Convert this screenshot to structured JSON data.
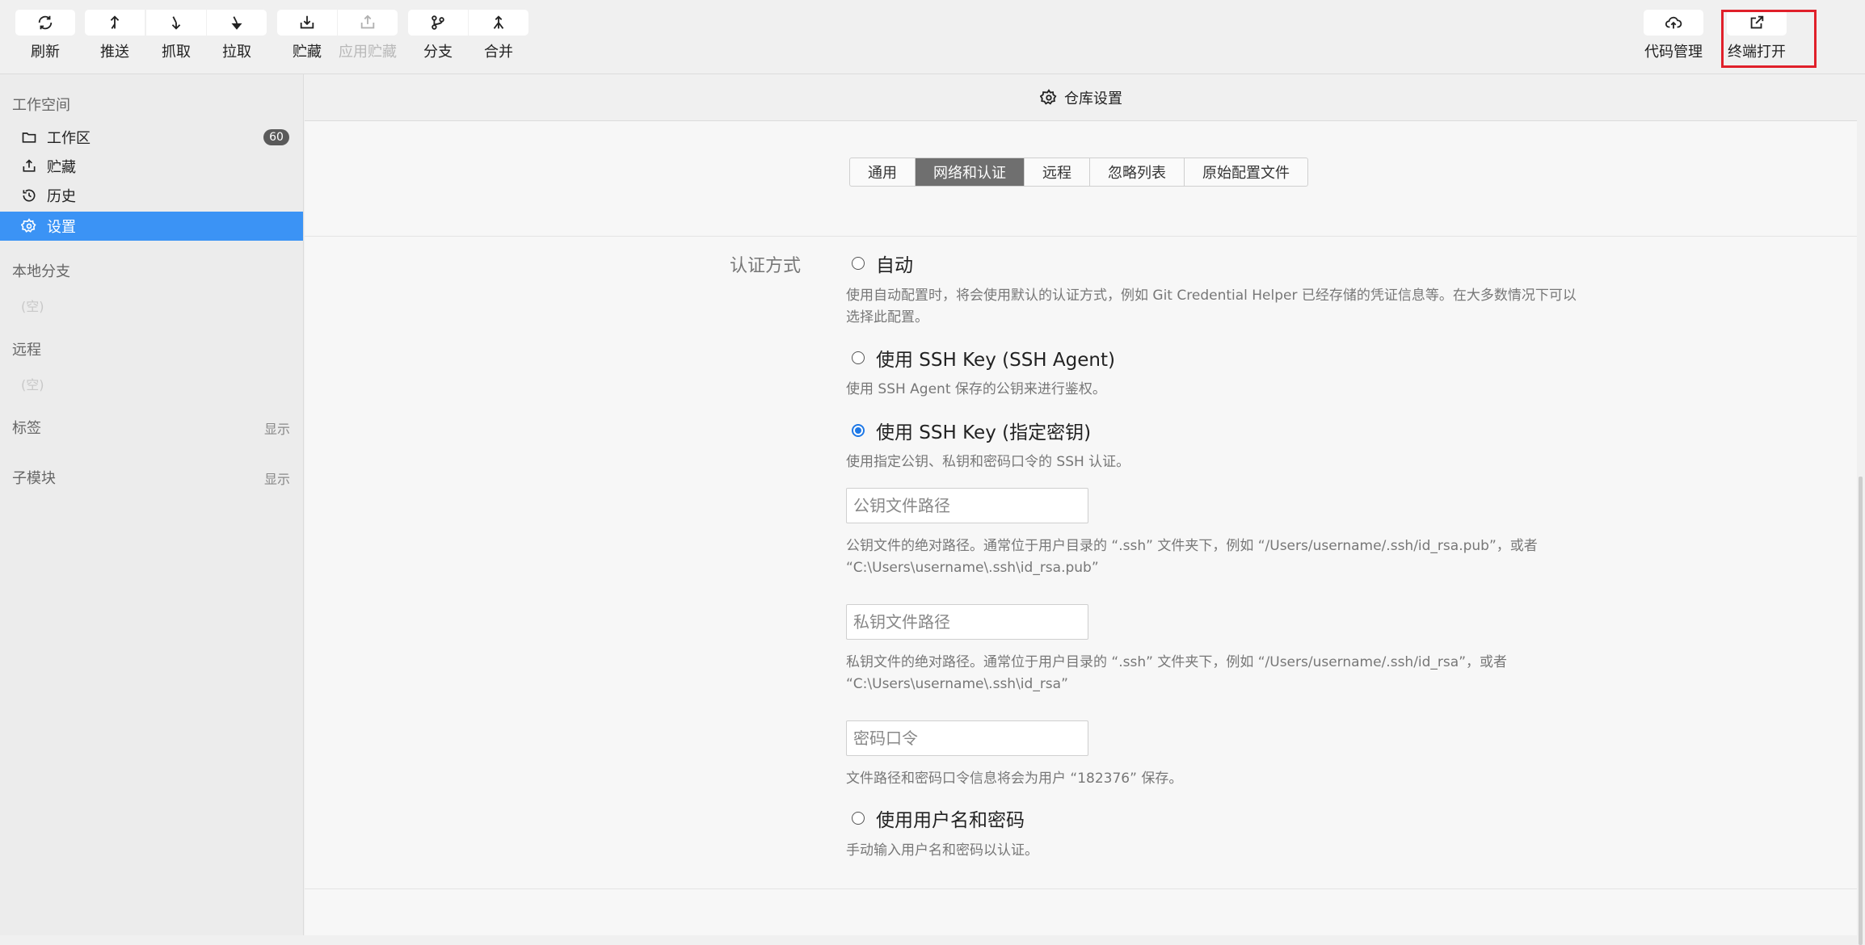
{
  "toolbar": {
    "refresh": "刷新",
    "push": "推送",
    "fetch": "抓取",
    "pull": "拉取",
    "stash": "贮藏",
    "apply_stash": "应用贮藏",
    "branch": "分支",
    "merge": "合并",
    "code_management": "代码管理",
    "open_in_terminal": "终端打开"
  },
  "sidebar": {
    "workspace_title": "工作空间",
    "items": [
      {
        "label": "工作区",
        "badge": "60"
      },
      {
        "label": "贮藏"
      },
      {
        "label": "历史"
      },
      {
        "label": "设置"
      }
    ],
    "local_branches": "本地分支",
    "local_empty": "(空)",
    "remotes": "远程",
    "remotes_empty": "(空)",
    "tags": "标签",
    "tags_show": "显示",
    "submodules": "子模块",
    "submodules_show": "显示"
  },
  "main": {
    "title": "仓库设置",
    "tabs": [
      "通用",
      "网络和认证",
      "远程",
      "忽略列表",
      "原始配置文件"
    ],
    "active_tab": "网络和认证",
    "auth_label": "认证方式",
    "options": {
      "auto": {
        "label": "自动",
        "desc": "使用自动配置时，将会使用默认的认证方式，例如 Git Credential Helper 已经存储的凭证信息等。在大多数情况下可以选择此配置。"
      },
      "ssh_agent": {
        "label": "使用 SSH Key (SSH Agent)",
        "desc": "使用 SSH Agent 保存的公钥来进行鉴权。"
      },
      "ssh_key": {
        "label": "使用 SSH Key (指定密钥)",
        "desc": "使用指定公钥、私钥和密码口令的 SSH 认证。"
      },
      "user_pass": {
        "label": "使用用户名和密码",
        "desc": "手动输入用户名和密码以认证。"
      }
    },
    "selected_option": "ssh_key",
    "public_key": {
      "value": "",
      "placeholder": "公钥文件路径",
      "desc": "公钥文件的绝对路径。通常位于用户目录的 “.ssh” 文件夹下，例如 “/Users/username/.ssh/id_rsa.pub”，或者 “C:\\Users\\username\\.ssh\\id_rsa.pub”"
    },
    "private_key": {
      "value": "",
      "placeholder": "私钥文件路径",
      "desc": "私钥文件的绝对路径。通常位于用户目录的 “.ssh” 文件夹下，例如 “/Users/username/.ssh/id_rsa”，或者 “C:\\Users\\username\\.ssh\\id_rsa”"
    },
    "passphrase": {
      "value": "",
      "placeholder": "密码口令",
      "desc": "文件路径和密码口令信息将会为用户 “182376” 保存。"
    }
  },
  "colors": {
    "accent": "#3b93f5",
    "highlight": "#e0202a",
    "radio_checked": "#1e78e6"
  }
}
